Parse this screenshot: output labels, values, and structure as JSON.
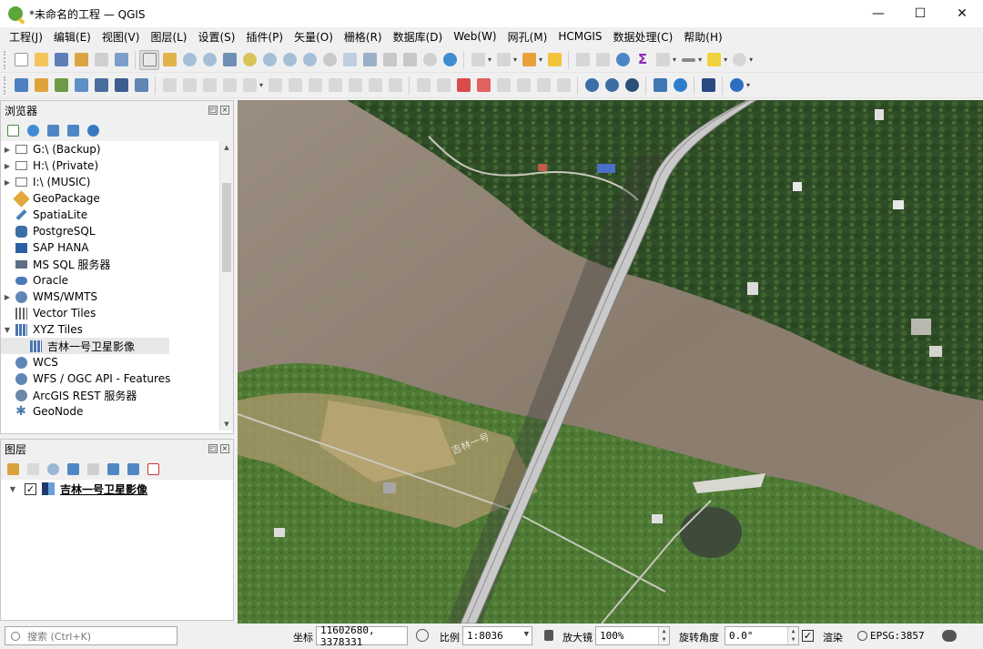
{
  "window": {
    "title": "*未命名的工程 — QGIS",
    "minimize": "—",
    "maximize": "☐",
    "close": "✕"
  },
  "menu": [
    "工程(J)",
    "编辑(E)",
    "视图(V)",
    "图层(L)",
    "设置(S)",
    "插件(P)",
    "矢量(O)",
    "栅格(R)",
    "数据库(D)",
    "Web(W)",
    "网孔(M)",
    "HCMGIS",
    "数据处理(C)",
    "帮助(H)"
  ],
  "browser_panel": {
    "title": "浏览器",
    "items": [
      {
        "label": "G:\\ (Backup)",
        "icon": "folder-icon",
        "expandable": true
      },
      {
        "label": "H:\\ (Private)",
        "icon": "folder-icon",
        "expandable": true
      },
      {
        "label": "I:\\ (MUSIC)",
        "icon": "folder-icon",
        "expandable": true
      },
      {
        "label": "GeoPackage",
        "icon": "geopackage-icon",
        "expandable": false
      },
      {
        "label": "SpatiaLite",
        "icon": "spatialite-icon",
        "expandable": false
      },
      {
        "label": "PostgreSQL",
        "icon": "postgresql-icon",
        "expandable": false
      },
      {
        "label": "SAP HANA",
        "icon": "sap-hana-icon",
        "expandable": false
      },
      {
        "label": "MS SQL 服务器",
        "icon": "mssql-icon",
        "expandable": false
      },
      {
        "label": "Oracle",
        "icon": "oracle-icon",
        "expandable": false
      },
      {
        "label": "WMS/WMTS",
        "icon": "globe-icon",
        "expandable": true
      },
      {
        "label": "Vector Tiles",
        "icon": "vector-tiles-icon",
        "expandable": false
      },
      {
        "label": "XYZ Tiles",
        "icon": "xyz-tiles-icon",
        "expandable": true,
        "expanded": true
      },
      {
        "label": "吉林一号卫星影像",
        "icon": "xyz-tiles-icon",
        "child": true,
        "selected": true
      },
      {
        "label": "WCS",
        "icon": "globe-icon",
        "expandable": false
      },
      {
        "label": "WFS / OGC API - Features",
        "icon": "globe-icon",
        "expandable": false
      },
      {
        "label": "ArcGIS REST 服务器",
        "icon": "arcgis-icon",
        "expandable": false
      },
      {
        "label": "GeoNode",
        "icon": "geonode-icon",
        "expandable": false
      }
    ]
  },
  "layers_panel": {
    "title": "图层",
    "layer": {
      "name": "吉林一号卫星影像",
      "checked": "✓"
    }
  },
  "map": {
    "bridge_label": "吉林一号"
  },
  "statusbar": {
    "search_placeholder": "搜索 (Ctrl+K)",
    "coord_label": "坐标",
    "coord_value": "11602680, 3378331",
    "scale_label": "比例",
    "scale_value": "1:8036",
    "magnifier_label": "放大镜",
    "magnifier_value": "100%",
    "rotation_label": "旋转角度",
    "rotation_value": "0.0°",
    "render_label": "渲染",
    "render_checked": "✓",
    "crs": "EPSG:3857"
  }
}
